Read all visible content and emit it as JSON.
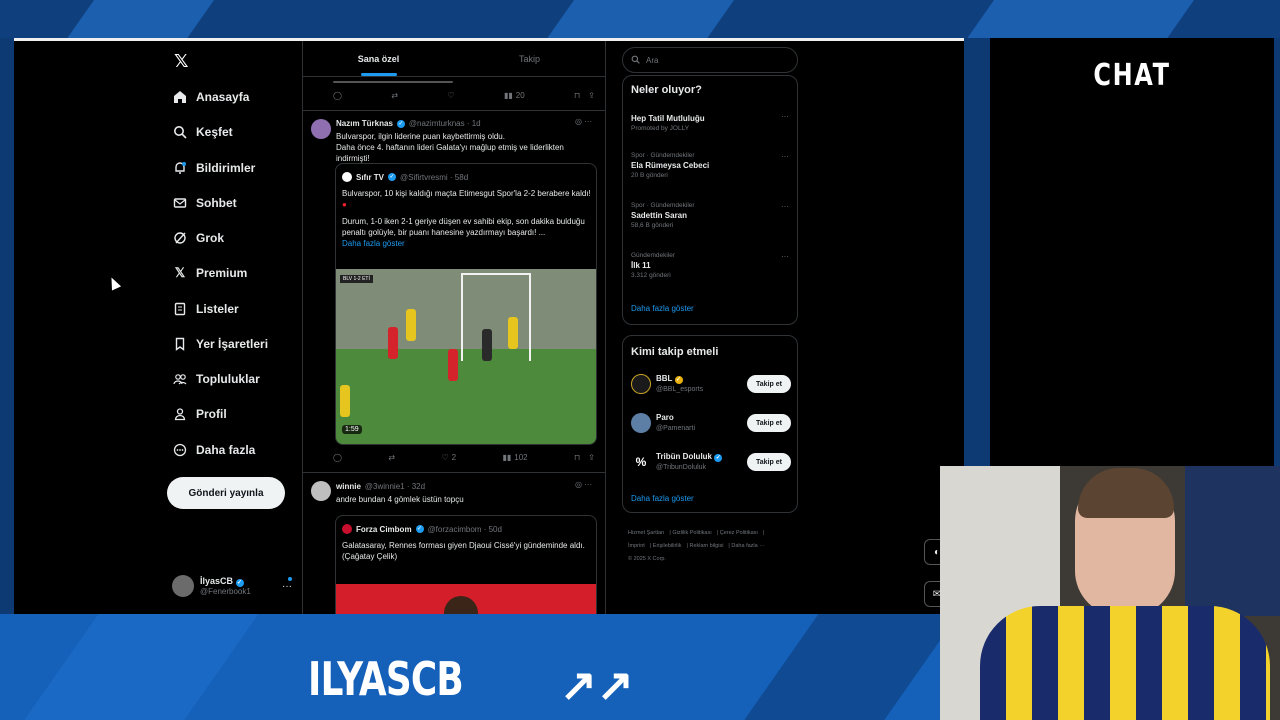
{
  "nav": {
    "items": [
      {
        "label": "Anasayfa",
        "icon": "home-icon"
      },
      {
        "label": "Keşfet",
        "icon": "search-icon"
      },
      {
        "label": "Bildirimler",
        "icon": "bell-icon"
      },
      {
        "label": "Sohbet",
        "icon": "mail-icon"
      },
      {
        "label": "Grok",
        "icon": "grok-icon"
      },
      {
        "label": "Premium",
        "icon": "x-icon"
      },
      {
        "label": "Listeler",
        "icon": "list-icon"
      },
      {
        "label": "Yer İşaretleri",
        "icon": "bookmark-icon"
      },
      {
        "label": "Topluluklar",
        "icon": "people-icon"
      },
      {
        "label": "Profil",
        "icon": "person-icon"
      },
      {
        "label": "Daha fazla",
        "icon": "more-circle-icon"
      }
    ],
    "post_label": "Gönderi yayınla",
    "profile": {
      "name": "İlyasCB",
      "handle": "@Fenerbook1"
    }
  },
  "tabs": [
    "Sana özel",
    "Takip"
  ],
  "top_actions": {
    "views": "20"
  },
  "tweet1": {
    "name": "Nazım Türknas",
    "handle": "@nazimturknas · 1d",
    "text1": "Bulvarspor, ilgin liderine puan kaybettirmiş oldu.",
    "text2": "Daha önce 4. haftanın lideri Galata'yı mağlup etmiş ve liderlikten indirmişti!",
    "quote": {
      "name": "Sıfır TV",
      "handle": "@Sifirtvresmi · 58d",
      "text1": "Bulvarspor, 10 kişi kaldığı maçta Etimesgut Spor'la 2-2 berabere kaldı!",
      "text2": "Durum, 1-0 iken 2-1 geriye düşen ev sahibi ekip, son dakika bulduğu",
      "text3": "penaltı golüyle, bir puanı hanesine yazdırmayı başardı! ...",
      "show_more": "Daha fazla göster",
      "video_time": "1:59"
    },
    "likes": "2",
    "views": "102"
  },
  "tweet2": {
    "name": "winnie",
    "handle": "@3winnie1 · 32d",
    "text": "andre bundan 4 gömlek üstün topçu",
    "quote": {
      "name": "Forza Cimbom",
      "handle": "@forzacimbom · 50d",
      "text1": "Galatasaray, Rennes forması giyen Djaoui Cissé'yi gündeminde aldı.",
      "text2": "(Çağatay Çelik)"
    }
  },
  "search": {
    "placeholder": "Ara"
  },
  "trends": {
    "title": "Neler oluyor?",
    "items": [
      {
        "cat": "",
        "title": "Hep Tatil Mutluluğu",
        "count": "Promoted by JOLLY"
      },
      {
        "cat": "Spor · Gündemdekiler",
        "title": "Ela Rümeysa Cebeci",
        "count": "20 B gönderi"
      },
      {
        "cat": "Spor · Gündemdekiler",
        "title": "Sadettin Saran",
        "count": "58,6 B gönderi"
      },
      {
        "cat": "Gündemdekiler",
        "title": "İlk 11",
        "count": "3.312 gönderi"
      }
    ],
    "show_more": "Daha fazla göster"
  },
  "who_to_follow": {
    "title": "Kimi takip etmeli",
    "items": [
      {
        "name": "BBL",
        "handle": "@BBL_esports",
        "btn": "Takip et"
      },
      {
        "name": "Paro",
        "handle": "@Pamenarti",
        "btn": "Takip et"
      },
      {
        "name": "Tribün Doluluk",
        "handle": "@TribunDoluluk",
        "btn": "Takip et"
      }
    ],
    "show_more": "Daha fazla göster"
  },
  "footer": [
    "Hizmet Şartları",
    "Gizlilik Politikası",
    "Çerez Politikası",
    "İmprint",
    "Erişilebilirlik",
    "Reklam bilgisi",
    "Daha fazla ···",
    "© 2025 X Corp."
  ],
  "chat_title": "CHAT",
  "brand": "ILYASCB"
}
